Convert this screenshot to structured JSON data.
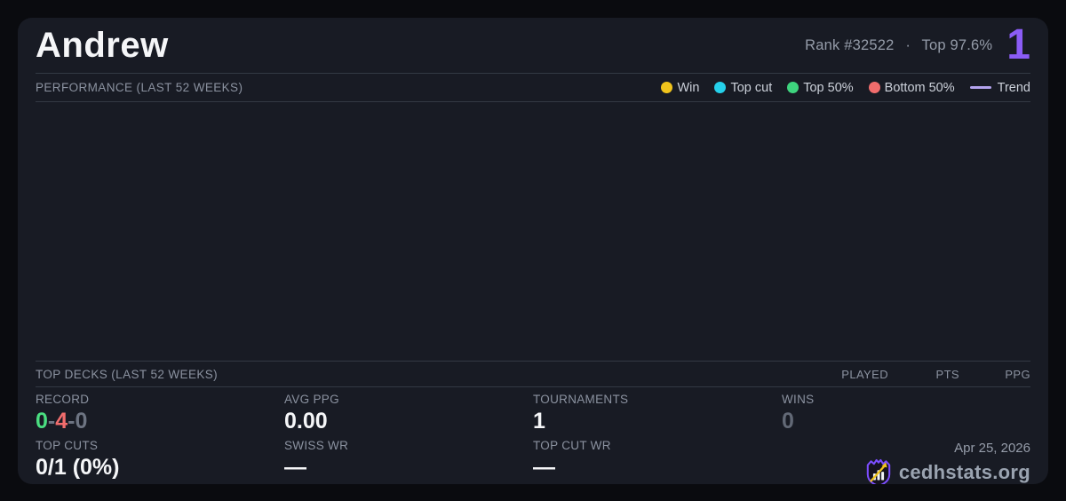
{
  "card": {
    "title": "Andrew",
    "rank_text": "Rank #32522",
    "dot_separator": "·",
    "top_percent_text": "Top 97.6%",
    "deck_count": "1"
  },
  "performance": {
    "section_title": "PERFORMANCE (LAST 52 WEEKS)",
    "legend": [
      {
        "label": "Win",
        "marker": "dot",
        "color": "#f0c41c"
      },
      {
        "label": "Top cut",
        "marker": "dot",
        "color": "#25d0ea"
      },
      {
        "label": "Top 50%",
        "marker": "dot",
        "color": "#3ed47e"
      },
      {
        "label": "Bottom 50%",
        "marker": "dot",
        "color": "#f06c6c"
      },
      {
        "label": "Trend",
        "marker": "line",
        "color": "#b4a4ef"
      }
    ],
    "chart_points": []
  },
  "top_decks": {
    "section_title": "TOP DECKS (LAST 52 WEEKS)",
    "columns": [
      "PLAYED",
      "PTS",
      "PPG"
    ],
    "rows": []
  },
  "stats": {
    "record": {
      "label": "RECORD",
      "wins": "0",
      "losses": "4",
      "draws": "0",
      "separator": "-"
    },
    "avg_ppg": {
      "label": "AVG PPG",
      "value": "0.00"
    },
    "tournaments": {
      "label": "TOURNAMENTS",
      "value": "1"
    },
    "wins": {
      "label": "WINS",
      "value": "0"
    },
    "top_cuts": {
      "label": "TOP CUTS",
      "value": "0/1 (0%)"
    },
    "swiss_wr": {
      "label": "SWISS WR",
      "value": "—"
    },
    "top_cut_wr": {
      "label": "TOP CUT WR",
      "value": "—"
    }
  },
  "footer": {
    "date": "Apr 25, 2026",
    "brand": "cedhstats.org"
  },
  "colors": {
    "background": "#0a0b0f",
    "card": "#181b24",
    "accent_purple": "#8b5cf6",
    "record_win_green": "#4ade80",
    "record_loss_red": "#f16d6d",
    "record_draw_gray": "#6d7482",
    "logo_purple": "#7c4dff",
    "logo_gold": "#f0c41c"
  }
}
